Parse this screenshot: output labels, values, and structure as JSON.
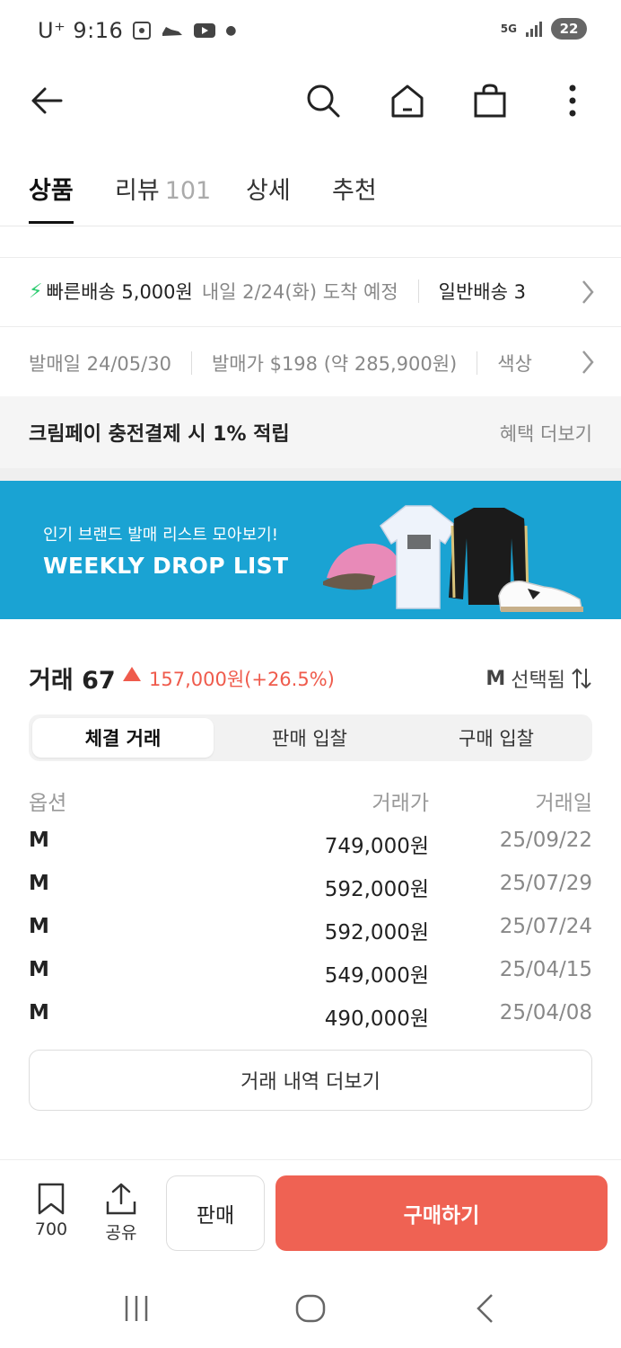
{
  "status_bar": {
    "carrier": "U⁺",
    "time": "9:16",
    "network": "5G",
    "battery": "22"
  },
  "header": {
    "back_icon": "arrow-left-icon",
    "search_icon": "search-icon",
    "home_icon": "home-icon",
    "bag_icon": "shopping-bag-icon",
    "menu_icon": "more-vertical-icon"
  },
  "tabs": [
    {
      "label": "상품",
      "count": ""
    },
    {
      "label": "리뷰",
      "count": "101"
    },
    {
      "label": "상세",
      "count": ""
    },
    {
      "label": "추천",
      "count": ""
    }
  ],
  "delivery": {
    "fast_label": "빠른배송 5,000원",
    "fast_eta": "내일 2/24(화) 도착 예정",
    "normal_label": "일반배송 3"
  },
  "release": {
    "date_label": "발매일 24/05/30",
    "price_label": "발매가 $198 (약 285,900원)",
    "color_label": "색상"
  },
  "kream_pay": {
    "title": "크림페이 충전결제 시 1% 적립",
    "more": "혜택 더보기"
  },
  "banner": {
    "subtitle": "인기 브랜드 발매 리스트 모아보기!",
    "title": "WEEKLY DROP LIST",
    "bg_color": "#1aa3d3"
  },
  "trades": {
    "label": "거래 67",
    "delta": "157,000원(+26.5%)",
    "delta_color": "#ef5b4c",
    "selected_size": "M",
    "selected_text": "선택됨",
    "segments": [
      "체결 거래",
      "판매 입찰",
      "구매 입찰"
    ],
    "columns": [
      "옵션",
      "거래가",
      "거래일"
    ],
    "rows": [
      {
        "option": "M",
        "price": "749,000원",
        "date": "25/09/22"
      },
      {
        "option": "M",
        "price": "592,000원",
        "date": "25/07/29"
      },
      {
        "option": "M",
        "price": "592,000원",
        "date": "25/07/24"
      },
      {
        "option": "M",
        "price": "549,000원",
        "date": "25/04/15"
      },
      {
        "option": "M",
        "price": "490,000원",
        "date": "25/04/08"
      }
    ],
    "more_button": "거래 내역 더보기"
  },
  "bottom_bar": {
    "bookmark_count": "700",
    "share_label": "공유",
    "sell_label": "판매",
    "buy_label": "구매하기",
    "buy_color": "#ef6253"
  }
}
